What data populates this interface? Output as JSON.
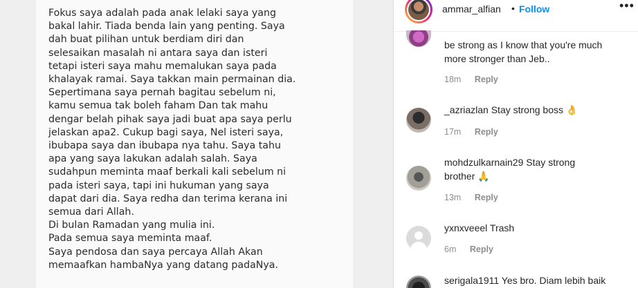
{
  "note": {
    "lines": [
      "Fokus saya adalah pada anak lelaki saya yang",
      "bakal lahir. Tiada benda lain yang penting. Saya",
      "dah buat pilihan untuk berdiam diri dan",
      "selesaikan masalah ni antara saya dan isteri",
      "tetapi isteri saya mahu memalukan saya pada",
      "khalayak ramai. Saya takkan main permainan dia.",
      "Sepertimana saya pernah bagitau sebelum ni,",
      "kamu semua tak boleh faham Dan tak mahu",
      "dengar belah pihak saya jadi buat apa saya perlu",
      "jelaskan apa2. Cukup bagi saya, Nel isteri saya,",
      "ibubapa saya dan ibubapa nya tahu. Saya tahu",
      "apa yang saya lakukan adalah salah. Saya",
      "sudahpun meminta maaf berkali kali sebelum ni",
      "pada isteri saya, tapi ini hukuman yang saya",
      "dapat dari dia. Saya redha dan terima kerana ini",
      "semua dari Allah.",
      "Di bulan Ramadan yang mulia ini.",
      "Pada semua saya meminta maaf.",
      "Saya pendosa dan saya percaya Allah Akan",
      "memaafkan hambaNya yang datang padaNya."
    ]
  },
  "header": {
    "username": "ammar_alfian",
    "separator": "•",
    "follow_label": "Follow",
    "more_icon": "more-horizontal-icon",
    "more_glyph": "•••"
  },
  "comments": [
    {
      "username": "",
      "text_line1": "be strong as I know that you're much",
      "text_line2": "more stronger than Jeb..",
      "emoji": "",
      "time": "18m",
      "reply_label": "Reply"
    },
    {
      "username": "_azriazlan",
      "text_line1": "Stay strong boss",
      "text_line2": "",
      "emoji": "👌",
      "time": "17m",
      "reply_label": "Reply"
    },
    {
      "username": "mohdzulkarnain29",
      "text_line1": "Stay strong",
      "text_line2": "brother",
      "emoji": "🙏",
      "time": "13m",
      "reply_label": "Reply"
    },
    {
      "username": "yxnxveeel",
      "text_line1": "Trash",
      "text_line2": "",
      "emoji": "",
      "time": "6m",
      "reply_label": "Reply"
    },
    {
      "username": "serigala1911",
      "text_line1": "Yes bro. Diam lebih baik",
      "text_line2": "",
      "emoji": "",
      "time": "",
      "reply_label": ""
    }
  ],
  "colors": {
    "follow": "#0095f6",
    "meta": "#8e8e8e",
    "text": "#262626"
  }
}
